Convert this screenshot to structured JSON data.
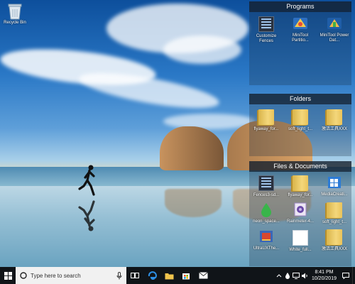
{
  "desktop": {
    "icons": [
      {
        "label": "Recycle Bin",
        "icon": "recycle-bin-icon"
      }
    ]
  },
  "fences": [
    {
      "title": "Programs",
      "items": [
        {
          "label": "Customize Fences",
          "icon": "fences-app-icon"
        },
        {
          "label": "MiniTool Partitio...",
          "icon": "minitool-partition-icon"
        },
        {
          "label": "MiniTool Power Dat...",
          "icon": "minitool-power-data-icon"
        }
      ]
    },
    {
      "title": "Folders",
      "items": [
        {
          "label": "flyaway_for...",
          "icon": "folder-icon"
        },
        {
          "label": "soft_light_t...",
          "icon": "folder-icon"
        },
        {
          "label": "激活工具XXX",
          "icon": "folder-icon"
        }
      ]
    },
    {
      "title": "Files & Documents",
      "rows": [
        [
          {
            "label": "Fences3-sd...",
            "icon": "fences-app-icon"
          },
          {
            "label": "flyaway_for...",
            "icon": "folder-icon"
          },
          {
            "label": "MediaCreati...",
            "icon": "media-creation-icon"
          }
        ],
        [
          {
            "label": "neon_space...",
            "icon": "green-drop-icon"
          },
          {
            "label": "Rainmeter-4...",
            "icon": "rainmeter-icon"
          },
          {
            "label": "soft_light_t...",
            "icon": "folder-icon"
          }
        ],
        [
          {
            "label": "UltraUXThe...",
            "icon": "ultrauxtheme-icon"
          },
          {
            "label": "White_full...",
            "icon": "white-file-icon"
          },
          {
            "label": "激活工具XXX",
            "icon": "folder-icon"
          }
        ]
      ]
    }
  ],
  "taskbar": {
    "search_placeholder": "Type here to search",
    "time": "8:41 PM",
    "date": "10/20/2019",
    "pinned": [
      "task-view-icon",
      "edge-icon",
      "file-explorer-icon",
      "store-icon",
      "mail-icon"
    ],
    "tray": [
      "chevron-up-icon",
      "dropbox-icon",
      "network-icon",
      "volume-icon",
      "action-center-icon"
    ]
  },
  "colors": {
    "taskbar": "#101418",
    "fence_title": "#141e2d",
    "accent": "#1a73d9"
  }
}
